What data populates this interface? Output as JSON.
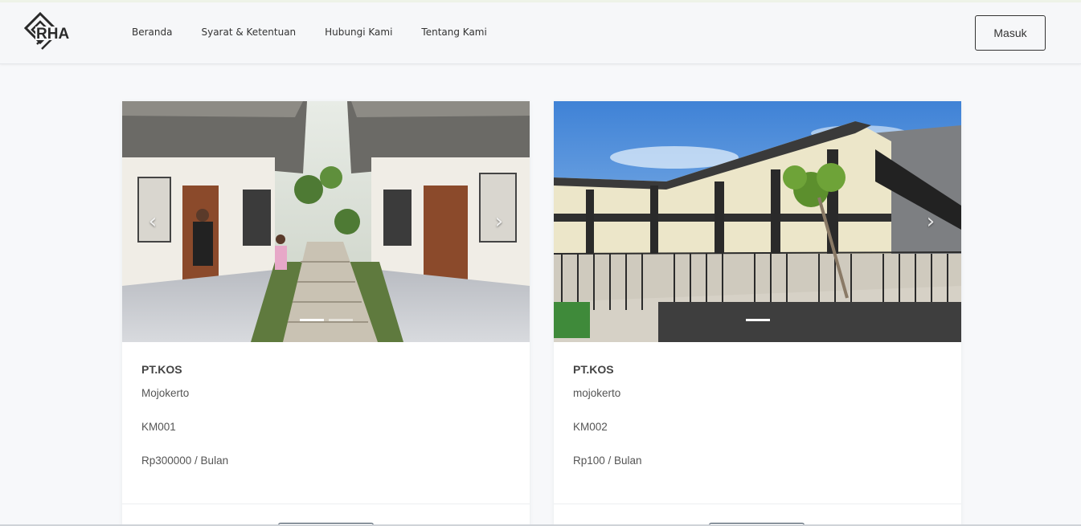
{
  "nav": {
    "logo_text": "RHA",
    "links": [
      "Beranda",
      "Syarat & Ketentuan",
      "Hubungi Kami",
      "Tentang Kami"
    ],
    "login_label": "Masuk"
  },
  "icons": {
    "prev": "chevron-left-icon",
    "next": "chevron-right-icon"
  },
  "listings": [
    {
      "title": "PT.KOS",
      "city": "Mojokerto",
      "code": "KM001",
      "price": "Rp300000 / Bulan",
      "slides": 2,
      "active_slide": 1
    },
    {
      "title": "PT.KOS",
      "city": "mojokerto",
      "code": "KM002",
      "price": "Rp100 / Bulan",
      "slides": 1,
      "active_slide": 1
    }
  ],
  "colors": {
    "navbar_bg": "#f6f7f9",
    "page_bg": "#f7f8fa",
    "text": "#333333"
  }
}
